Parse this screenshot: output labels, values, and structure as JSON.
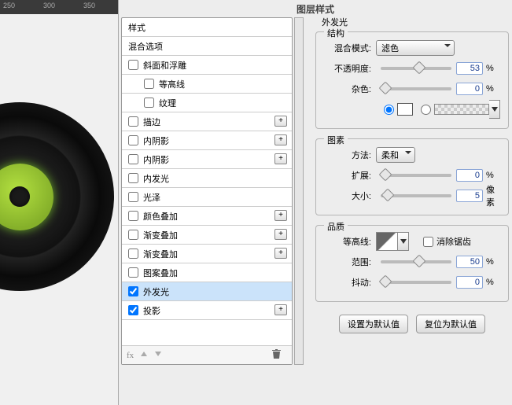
{
  "ruler": [
    "250",
    "300",
    "350"
  ],
  "dialog_title": "图层样式",
  "sidebar": {
    "header_styles": "样式",
    "header_blend": "混合选项",
    "items": [
      {
        "label": "斜面和浮雕",
        "checked": false,
        "plus": false
      },
      {
        "label": "等高线",
        "checked": false,
        "plus": false,
        "indent": true
      },
      {
        "label": "纹理",
        "checked": false,
        "plus": false,
        "indent": true
      },
      {
        "label": "描边",
        "checked": false,
        "plus": true
      },
      {
        "label": "内阴影",
        "checked": false,
        "plus": true
      },
      {
        "label": "内阴影",
        "checked": false,
        "plus": true
      },
      {
        "label": "内发光",
        "checked": false,
        "plus": false
      },
      {
        "label": "光泽",
        "checked": false,
        "plus": false
      },
      {
        "label": "颜色叠加",
        "checked": false,
        "plus": true
      },
      {
        "label": "渐变叠加",
        "checked": false,
        "plus": true
      },
      {
        "label": "渐变叠加",
        "checked": false,
        "plus": true
      },
      {
        "label": "图案叠加",
        "checked": false,
        "plus": false
      },
      {
        "label": "外发光",
        "checked": true,
        "plus": false,
        "selected": true
      },
      {
        "label": "投影",
        "checked": true,
        "plus": true
      }
    ],
    "footer_fx": "fx"
  },
  "right": {
    "outer_glow_title": "外发光",
    "structure_title": "结构",
    "blend_mode_label": "混合模式:",
    "blend_mode_value": "滤色",
    "opacity_label": "不透明度:",
    "opacity_value": "53",
    "noise_label": "杂色:",
    "noise_value": "0",
    "pct": "%",
    "elements_title": "图素",
    "technique_label": "方法:",
    "technique_value": "柔和",
    "spread_label": "扩展:",
    "spread_value": "0",
    "size_label": "大小:",
    "size_value": "5",
    "px": "像素",
    "quality_title": "品质",
    "contour_label": "等高线:",
    "anti_alias": "消除锯齿",
    "range_label": "范围:",
    "range_value": "50",
    "jitter_label": "抖动:",
    "jitter_value": "0",
    "make_default": "设置为默认值",
    "reset_default": "复位为默认值"
  }
}
